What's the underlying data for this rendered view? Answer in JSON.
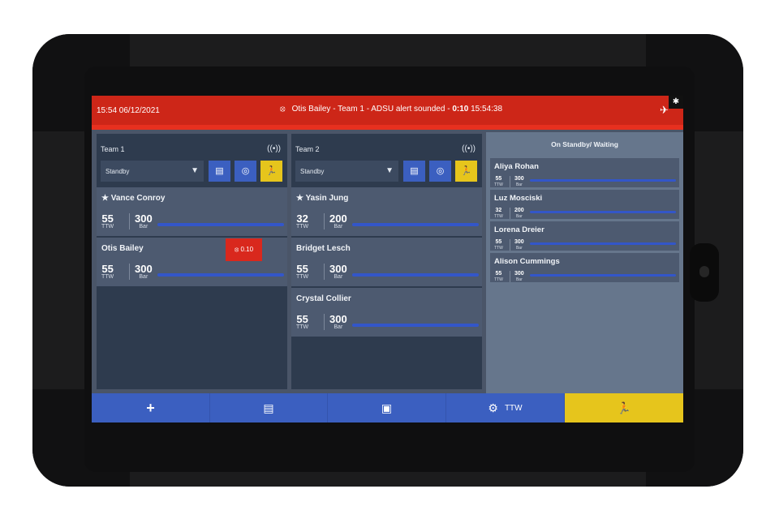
{
  "topbar": {
    "datetime": "15:54 06/12/2021",
    "alert_text": "Otis Bailey - Team 1 - ADSU alert sounded - ",
    "alert_elapsed": "0:10",
    "alert_time": "15:54:38"
  },
  "teams": [
    {
      "title": "Team 1",
      "status": "Standby",
      "members": [
        {
          "name": "★ Vance Conroy",
          "ttw": "55",
          "ttw_unit": "TTW",
          "bar": "300",
          "bar_unit": "Bar"
        },
        {
          "name": "Otis Bailey",
          "ttw": "55",
          "ttw_unit": "TTW",
          "bar": "300",
          "bar_unit": "Bar",
          "alert": "0.10"
        }
      ]
    },
    {
      "title": "Team 2",
      "status": "Standby",
      "members": [
        {
          "name": "★ Yasin Jung",
          "ttw": "32",
          "ttw_unit": "TTW",
          "bar": "200",
          "bar_unit": "Bar"
        },
        {
          "name": "Bridget Lesch",
          "ttw": "55",
          "ttw_unit": "TTW",
          "bar": "300",
          "bar_unit": "Bar"
        },
        {
          "name": "Crystal Collier",
          "ttw": "55",
          "ttw_unit": "TTW",
          "bar": "300",
          "bar_unit": "Bar"
        }
      ]
    }
  ],
  "standby": {
    "title": "On Standby/ Waiting",
    "members": [
      {
        "name": "Aliya Rohan",
        "ttw": "55",
        "ttw_unit": "TTW",
        "bar": "300",
        "bar_unit": "Bar"
      },
      {
        "name": "Luz Mosciski",
        "ttw": "32",
        "ttw_unit": "TTW",
        "bar": "200",
        "bar_unit": "Bar"
      },
      {
        "name": "Lorena Dreier",
        "ttw": "55",
        "ttw_unit": "TTW",
        "bar": "300",
        "bar_unit": "Bar"
      },
      {
        "name": "Alison Cummings",
        "ttw": "55",
        "ttw_unit": "TTW",
        "bar": "300",
        "bar_unit": "Bar"
      }
    ]
  },
  "bottombar": {
    "ttw_label": "TTW"
  },
  "colors": {
    "alert_red": "#cd2618",
    "action_blue": "#3b5fc0",
    "evacuate_yellow": "#e6c51c",
    "panel_dark": "#2e3b4e"
  },
  "icons": [
    "radio-signal-icon",
    "caret-down-icon",
    "add-entry-icon",
    "target-icon",
    "evacuate-icon",
    "plus-icon",
    "briefcase-icon",
    "settings-icon",
    "mute-icon",
    "gear-icon",
    "alarm-icon"
  ]
}
